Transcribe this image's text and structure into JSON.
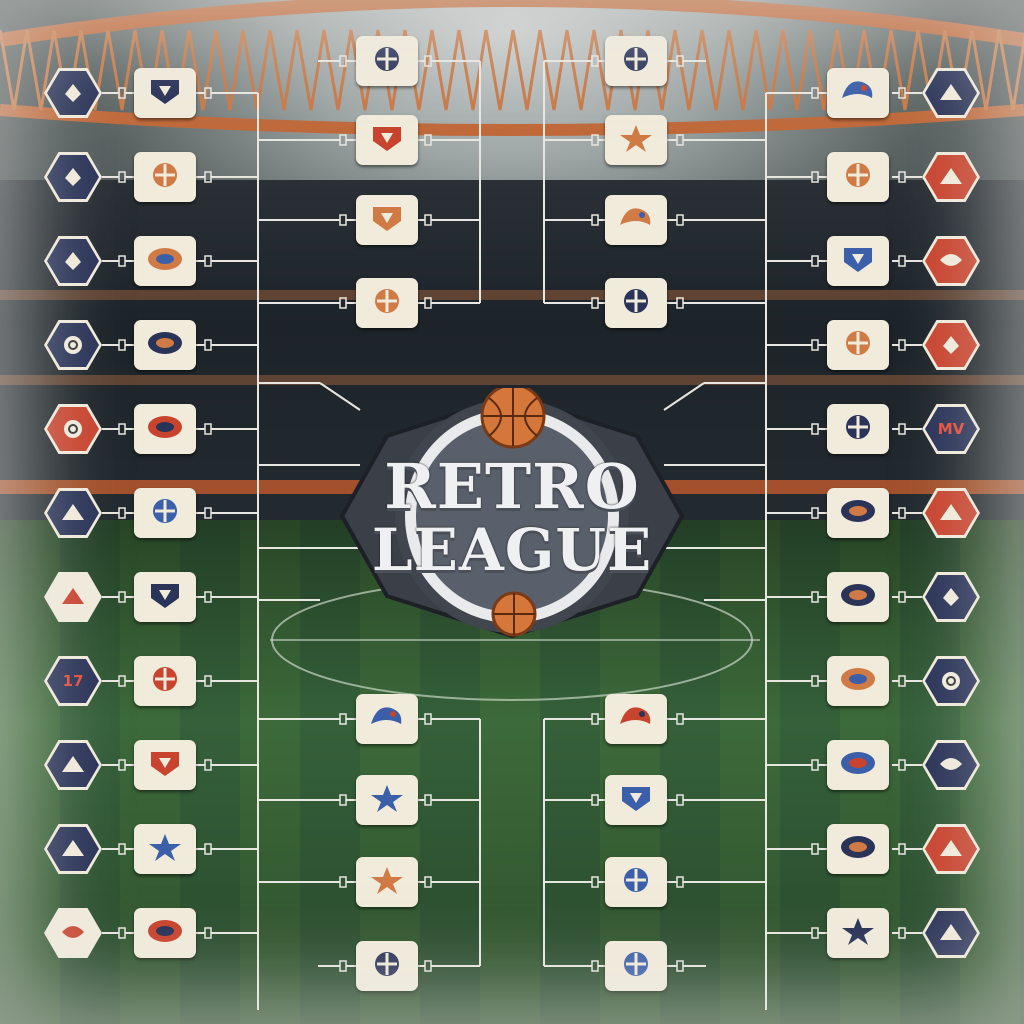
{
  "logo": {
    "line1": "RETRO",
    "line2": "LEAGUE"
  },
  "colors": {
    "navy": "#2a3358",
    "red": "#c8442f",
    "cream": "#f1ebdc",
    "bracket_line": "#e8e6e0",
    "orange": "#d07a45"
  },
  "left_seeds": [
    {
      "icon": "rocket-logo-icon",
      "color": "navy"
    },
    {
      "icon": "wings-logo-icon",
      "color": "navy"
    },
    {
      "icon": "pennant-logo-icon",
      "color": "navy"
    },
    {
      "icon": "banner-logo-icon",
      "color": "navy"
    },
    {
      "icon": "trident-logo-icon",
      "color": "red"
    },
    {
      "icon": "swoosh-logo-icon",
      "color": "navy"
    },
    {
      "icon": "bull-logo-icon",
      "color": "cream"
    },
    {
      "icon": "jersey-number-logo-icon",
      "color": "navy",
      "text": "17"
    },
    {
      "icon": "badge-logo-icon",
      "color": "navy"
    },
    {
      "icon": "hawk-logo-icon",
      "color": "navy"
    },
    {
      "icon": "script-logo-icon",
      "color": "cream"
    }
  ],
  "left_round1": [
    "shield-logo-icon",
    "eagle-logo-icon",
    "star-logo-icon",
    "bird-logo-icon",
    "ring-logo-icon",
    "dragon-logo-icon",
    "fox-logo-icon",
    "wolf-logo-icon",
    "mask-logo-icon",
    "wordmark-logo-icon",
    "footprints-logo-icon"
  ],
  "left_round2": [
    "horse-logo-icon",
    "cap-logo-icon",
    "fist-logo-icon",
    "oval-wordmark-logo-icon",
    "helmet-logo-icon",
    "pennant-flag-logo-icon",
    "runner-logo-icon",
    "crest-logo-icon"
  ],
  "right_round2": [
    "rectangle-wordmark-logo-icon",
    "fish-logo-icon",
    "lion-logo-icon",
    "knight-logo-icon",
    "ticket-logo-icon",
    "claw-logo-icon",
    "cloud-logo-icon",
    "bull-horn-logo-icon"
  ],
  "right_round1": [
    "helmet-logo-icon",
    "oval-wordmark-logo-icon",
    "jet-logo-icon",
    "bear-logo-icon",
    "crest-logo-icon",
    "wing-logo-icon",
    "eagle-head-logo-icon",
    "star-logo-icon",
    "mustang-logo-icon",
    "shark-logo-icon",
    "globe-logo-icon"
  ],
  "right_seeds": [
    {
      "icon": "arrow-logo-icon",
      "color": "navy"
    },
    {
      "icon": "skull-logo-icon",
      "color": "red"
    },
    {
      "icon": "hex-logo-icon",
      "color": "red"
    },
    {
      "icon": "fox-head-logo-icon",
      "color": "red"
    },
    {
      "icon": "letters-logo-icon",
      "color": "navy",
      "text": "MV"
    },
    {
      "icon": "dragon-logo-icon",
      "color": "red"
    },
    {
      "icon": "monogram-logo-icon",
      "color": "navy"
    },
    {
      "icon": "letter-a-logo-icon",
      "color": "navy"
    },
    {
      "icon": "shield-logo-icon",
      "color": "navy"
    },
    {
      "icon": "eye-logo-icon",
      "color": "red"
    },
    {
      "icon": "badge-logo-icon",
      "color": "navy"
    }
  ]
}
